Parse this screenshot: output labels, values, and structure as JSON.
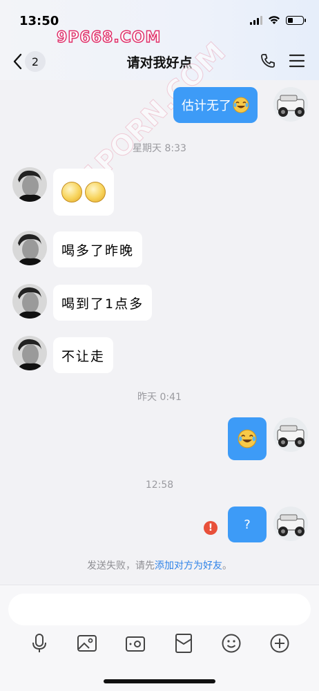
{
  "status": {
    "time": "13:50"
  },
  "watermarks": {
    "top": "9P668.COM",
    "diagonal": "91PORN.COM"
  },
  "nav": {
    "unread_count": "2",
    "title": "请对我好点"
  },
  "messages": [
    {
      "side": "out",
      "text": "估计无了",
      "emoji": "laugh-cry"
    },
    {
      "timestamp": "星期天 8:33"
    },
    {
      "side": "in",
      "emoji": "smile x2"
    },
    {
      "side": "in",
      "text": "喝多了昨晚"
    },
    {
      "side": "in",
      "text": "喝到了1点多"
    },
    {
      "side": "in",
      "text": "不让走"
    },
    {
      "timestamp": "昨天 0:41"
    },
    {
      "side": "out",
      "emoji": "laugh-cry"
    },
    {
      "timestamp": "12:58"
    },
    {
      "side": "out",
      "text": "?",
      "failed": true
    }
  ],
  "chat": {
    "m1_text": "估计无了",
    "ts1": "星期天 8:33",
    "m3_text": "喝多了昨晚",
    "m4_text": "喝到了1点多",
    "m5_text": "不让走",
    "ts2": "昨天 0:41",
    "ts3": "12:58",
    "m7_text": "?",
    "fail_icon": "!",
    "fail_prefix": "发送失败，请先",
    "fail_link": "添加对方为好友",
    "fail_suffix": "。"
  },
  "input": {
    "placeholder": ""
  },
  "toolbar": [
    "voice-icon",
    "image-icon",
    "camera-icon",
    "red-packet-icon",
    "emoji-icon",
    "plus-icon"
  ],
  "colors": {
    "outgoing_bubble": "#3d9bf7",
    "link": "#2f83e8",
    "error": "#e8503a"
  }
}
